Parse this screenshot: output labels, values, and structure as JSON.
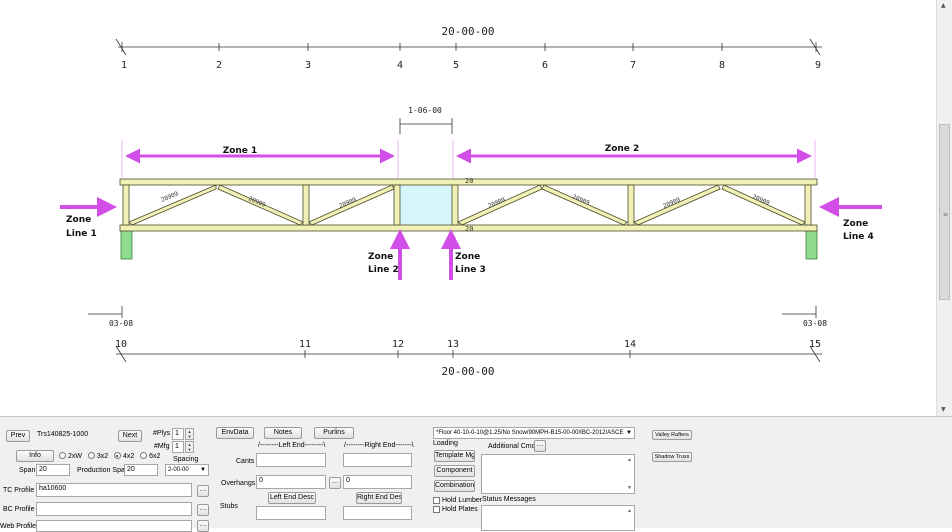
{
  "drawing": {
    "top_dimension": "20-00-00",
    "bottom_dimension": "20-00-00",
    "gap_dimension": "1-06-00",
    "top_panel_points": [
      "1",
      "2",
      "3",
      "4",
      "5",
      "6",
      "7",
      "8",
      "9"
    ],
    "bottom_panel_points": [
      "10",
      "11",
      "12",
      "13",
      "14",
      "15"
    ],
    "left_bearing": "03-08",
    "right_bearing": "03-08",
    "top_chord_label": "20",
    "bottom_chord_label": "20",
    "web_labels": [
      "20909",
      "20909",
      "20909",
      "20909",
      "20909",
      "20909",
      "20909"
    ],
    "zones": [
      "Zone 1",
      "Zone 2"
    ],
    "zone_lines": {
      "line1": [
        "Zone",
        "Line 1"
      ],
      "line2": [
        "Zone",
        "Line 2"
      ],
      "line3": [
        "Zone",
        "Line 3"
      ],
      "line4": [
        "Zone",
        "Line 4"
      ]
    },
    "colors": {
      "annotation": "#d14fe6",
      "chord": "#f1f1b6",
      "chord_stroke": "#4a4a2a",
      "gap_fill": "#d6f6fc",
      "bearing": "#8fdc8f"
    }
  },
  "panel": {
    "prev_label": "Prev",
    "next_label": "Next",
    "truss_name": "Trs140825-1000",
    "plys_label": "#Plys",
    "plys_value": "1",
    "mfg_label": "#Mfg",
    "mfg_value": "1",
    "info_label": "Info",
    "lumber_options": [
      "2xW",
      "3x2",
      "4x2",
      "6x2"
    ],
    "lumber_selected": "4x2",
    "spacing_label": "Spacing",
    "spacing_value": "2-00-00",
    "span_label": "Span",
    "span_value": "20",
    "production_span_label": "Production Span",
    "production_span_value": "20",
    "tc_profile_label": "TC Profile",
    "tc_profile_value": "ha10600",
    "bc_profile_label": "BC Profile",
    "bc_profile_value": "",
    "web_profile_label": "Web Profile",
    "web_profile_value": "",
    "env_data_label": "EnvData",
    "notes_label": "Notes",
    "purlins_label": "Purlins",
    "left_end_header": "/--------Left End--------\\",
    "right_end_header": "/--------Right End-------\\",
    "cants_label": "Cants",
    "overhangs_label": "Overhangs",
    "overhang_left_value": "0",
    "overhang_right_value": "0",
    "left_end_desc_label": "Left End Desc",
    "right_end_desc_label": "Right End Desc",
    "stubs_label": "Stubs",
    "loading_value": "*Floor 40-10-0-10@1.25/No Snow/90MPH-B15-00-00/IBC-2012/ASCE",
    "loading_label": "Loading",
    "template_mgr_label": "Template Mgr",
    "component_label": "Component",
    "combinations_label": "Combinations",
    "hold_lumber_label": "Hold Lumber",
    "hold_plates_label": "Hold Plates",
    "additional_cmds_label": "Additional Cmds",
    "status_messages_label": "Status Messages",
    "valley_rafters_label": "Valley Rafters",
    "shadow_truss_label": "Shadow Truss"
  }
}
